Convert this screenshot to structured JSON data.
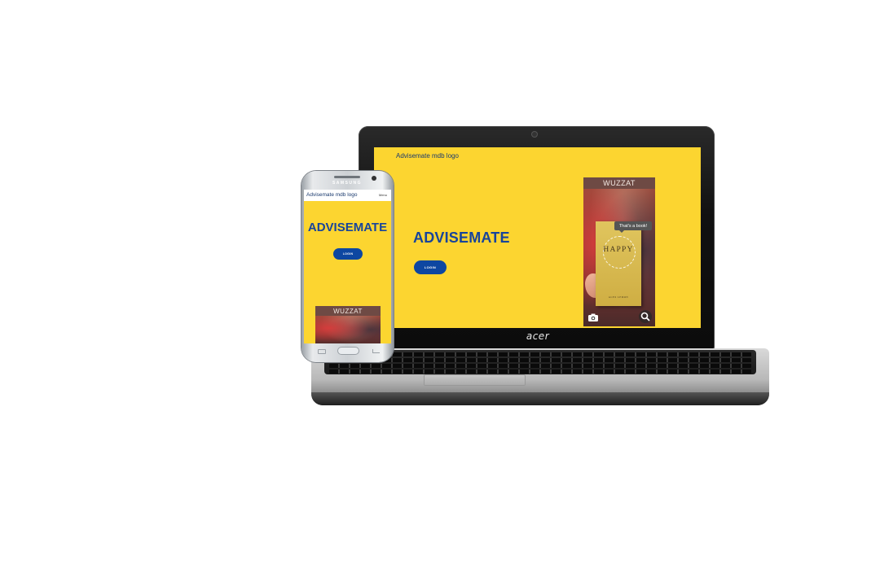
{
  "laptop": {
    "brand": "acer",
    "site": {
      "logo_text": "Advisemate mdb logo",
      "heading": "ADVISEMATE",
      "login_label": "LOGIN"
    },
    "app": {
      "title": "WUZZAT",
      "bubble": "That's a book!",
      "book_title": "HAPPY",
      "book_author": "ALEX LEMON",
      "icons": [
        "camera-icon",
        "search-icon"
      ]
    }
  },
  "phone": {
    "brand": "SAMSUNG",
    "site": {
      "logo_text": "Advisemate mdb logo",
      "menu_label": "Menu",
      "heading": "ADVISEMATE",
      "login_label": "LOGIN"
    },
    "app": {
      "title": "WUZZAT"
    }
  },
  "colors": {
    "background": "#fcd530",
    "heading": "#17449b",
    "button": "#0d47a1"
  }
}
